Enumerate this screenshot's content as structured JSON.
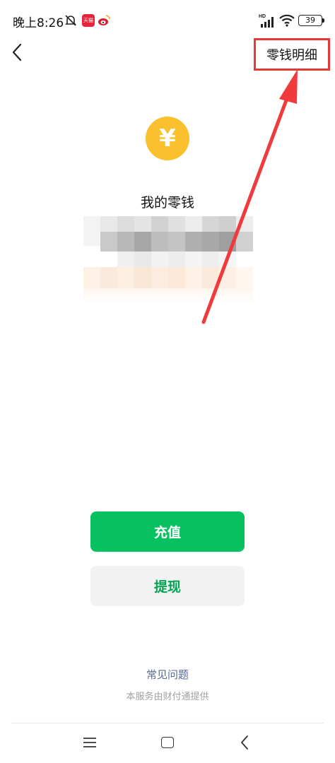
{
  "status_bar": {
    "time": "晚上8:26",
    "tmall_label": "天猫",
    "battery": "39"
  },
  "header": {
    "detail_label": "零钱明细"
  },
  "wallet": {
    "coin_symbol": "¥",
    "title": "我的零钱"
  },
  "actions": {
    "recharge_label": "充值",
    "withdraw_label": "提现"
  },
  "footer": {
    "faq_label": "常见问题",
    "service_note": "本服务由财付通提供"
  },
  "colors": {
    "accent_green": "#07c160",
    "coin_yellow": "#fbc02d",
    "annotation_red": "#e53935",
    "link_blue": "#576b95"
  },
  "icons": {
    "back": "chevron-left-icon",
    "coin": "yuan-coin-icon",
    "nav_menu": "menu-icon",
    "nav_home": "home-square-icon",
    "nav_back": "chevron-left-icon"
  }
}
